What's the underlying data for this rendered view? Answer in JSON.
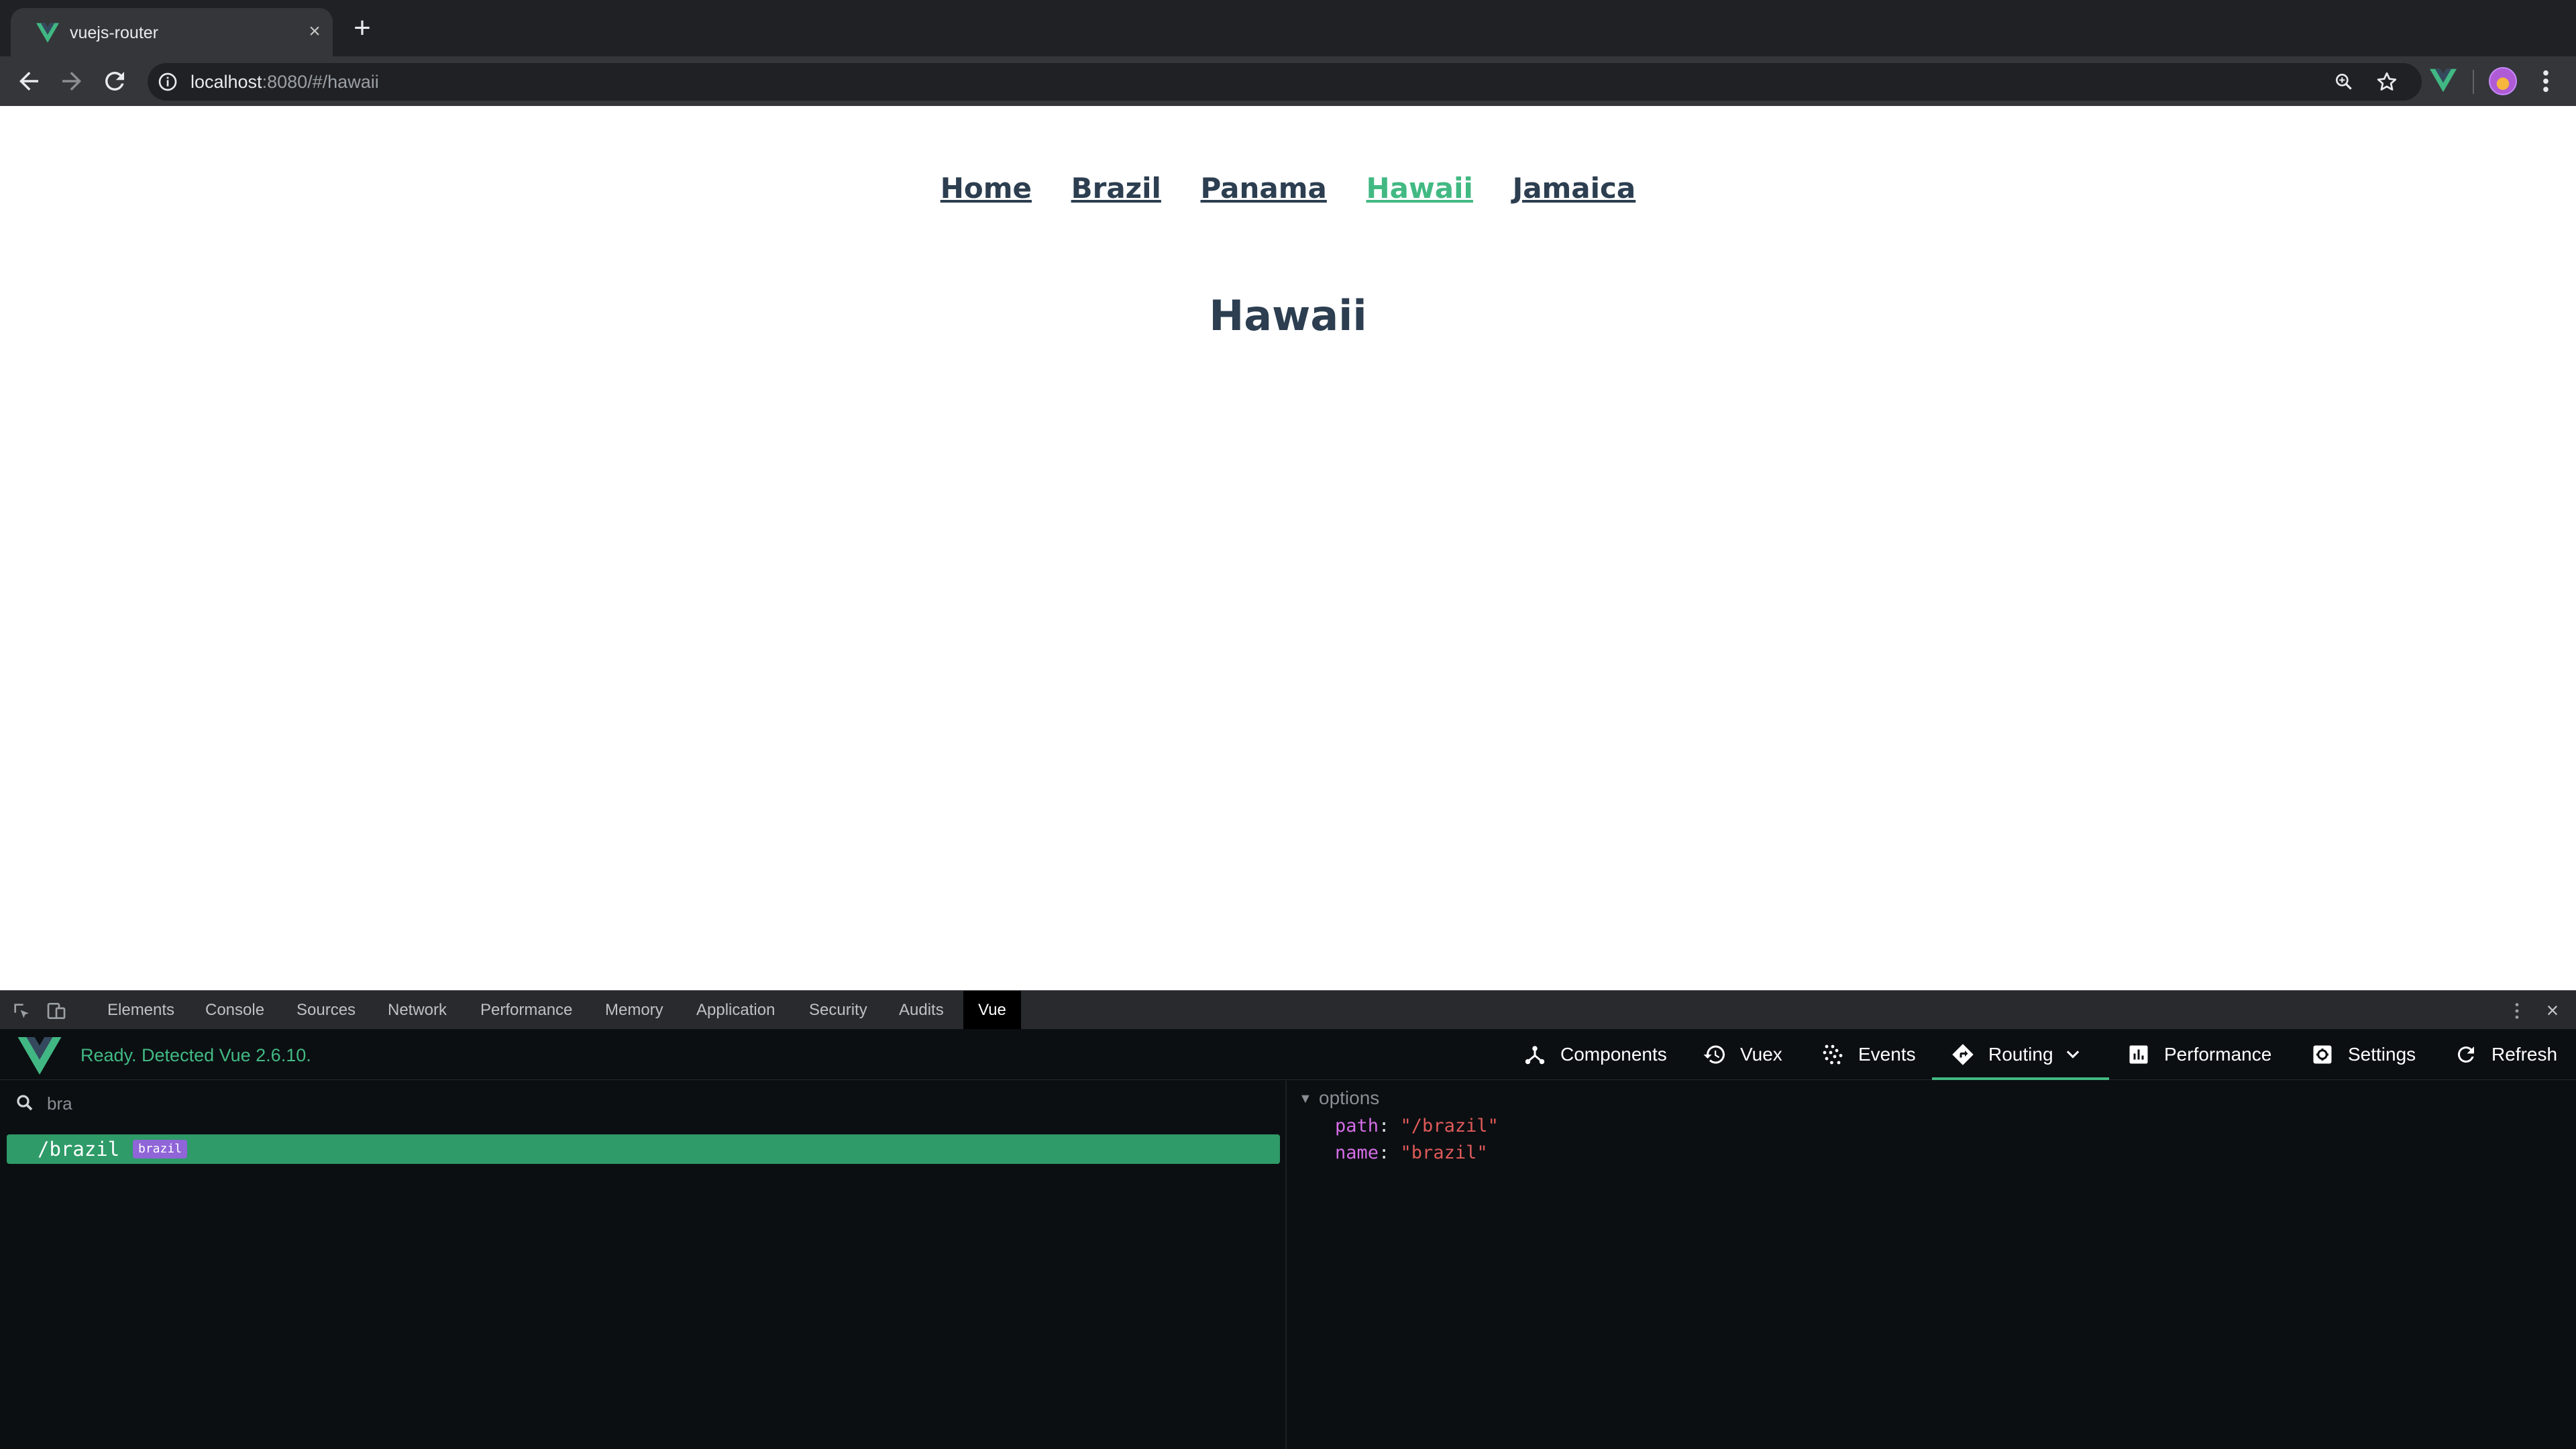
{
  "browser": {
    "tab_title": "vuejs-router",
    "url_host": "localhost",
    "url_rest": ":8080/#/hawaii"
  },
  "page": {
    "nav_links": [
      "Home",
      "Brazil",
      "Panama",
      "Hawaii",
      "Jamaica"
    ],
    "active_link": "Hawaii",
    "heading": "Hawaii"
  },
  "devtools": {
    "tabs": [
      "Elements",
      "Console",
      "Sources",
      "Network",
      "Performance",
      "Memory",
      "Application",
      "Security",
      "Audits",
      "Vue"
    ],
    "active_tab": "Vue"
  },
  "vue_devtools": {
    "status": "Ready. Detected Vue 2.6.10.",
    "nav": {
      "components": "Components",
      "vuex": "Vuex",
      "events": "Events",
      "routing": "Routing",
      "performance": "Performance",
      "settings": "Settings",
      "refresh": "Refresh"
    },
    "active_nav": "Routing",
    "search_value": "bra",
    "route": {
      "path": "/brazil",
      "badge": "brazil"
    },
    "details": {
      "section": "options",
      "path_key": "path",
      "path_value": "\"/brazil\"",
      "name_key": "name",
      "name_value": "\"brazil\""
    }
  },
  "colors": {
    "vue_green": "#42b983",
    "selected_row": "#2e9b68",
    "badge": "#8f65d8",
    "text_dark": "#2c3e50"
  }
}
